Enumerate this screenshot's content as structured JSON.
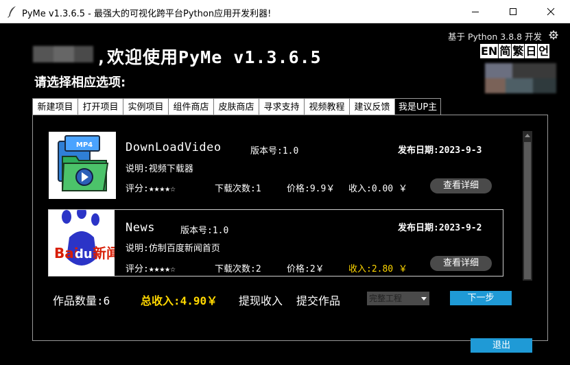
{
  "window": {
    "title": "PyMe v1.3.6.5 -  最强大的可视化跨平台Python应用开发利器!"
  },
  "header": {
    "welcome": ",欢迎使用PyMe v1.3.6.5",
    "subtitle": "请选择相应选项:",
    "python_version": "基于 Python 3.8.8 开发",
    "languages": [
      "EN",
      "简",
      "繁",
      "日",
      "언"
    ]
  },
  "tabs": [
    {
      "label": "新建项目"
    },
    {
      "label": "打开项目"
    },
    {
      "label": "实例项目"
    },
    {
      "label": "组件商店"
    },
    {
      "label": "皮肤商店"
    },
    {
      "label": "寻求支持"
    },
    {
      "label": "视频教程"
    },
    {
      "label": "建议反馈"
    },
    {
      "label": "我是UP主"
    }
  ],
  "works": [
    {
      "name": "DownLoadVideo",
      "version": "版本号:1.0",
      "date": "发布日期:2023-9-3",
      "desc": "说明:视频下载器",
      "rating": "评分:★★★★☆",
      "downloads": "下载次数:1",
      "price": "价格:9.9￥",
      "income": "收入:0.00 ￥",
      "image_label": "MP4",
      "detail_label": "查看详细"
    },
    {
      "name": "News",
      "version": "版本号:1.0",
      "date": "发布日期:2023-9-2",
      "desc": "说明:仿制百度新闻首页",
      "rating": "评分:★★★★☆",
      "downloads": "下载次数:2",
      "price": "价格:2￥",
      "income": "收入:2.80 ￥",
      "image_label": "Bai du 新闻",
      "detail_label": "查看详细"
    }
  ],
  "footer": {
    "count": "作品数量:6",
    "total_income": "总收入:4.90￥",
    "withdraw": "提现收入",
    "submit": "提交作品",
    "select_value": "完整工程",
    "next": "下一步",
    "exit": "退出"
  },
  "colors": {
    "accent_blue": "#1f9ad6",
    "income_yellow": "#ffd700",
    "background": "#000000"
  }
}
